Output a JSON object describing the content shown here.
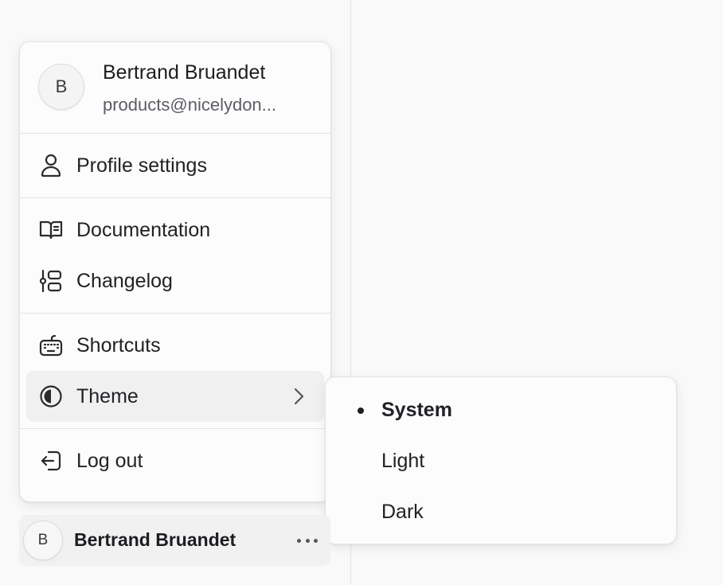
{
  "user": {
    "initial": "B",
    "name": "Bertrand Bruandet",
    "email": "products@nicelydon..."
  },
  "menu": {
    "items": [
      {
        "label": "Profile settings",
        "icon": "user-icon"
      },
      {
        "label": "Documentation",
        "icon": "book-icon"
      },
      {
        "label": "Changelog",
        "icon": "changelog-icon"
      },
      {
        "label": "Shortcuts",
        "icon": "keyboard-icon"
      },
      {
        "label": "Theme",
        "icon": "contrast-icon"
      },
      {
        "label": "Log out",
        "icon": "logout-icon"
      }
    ]
  },
  "theme_submenu": {
    "options": [
      "System",
      "Light",
      "Dark"
    ],
    "selected": "System"
  },
  "account_bar": {
    "initial": "B",
    "name": "Bertrand Bruandet"
  }
}
